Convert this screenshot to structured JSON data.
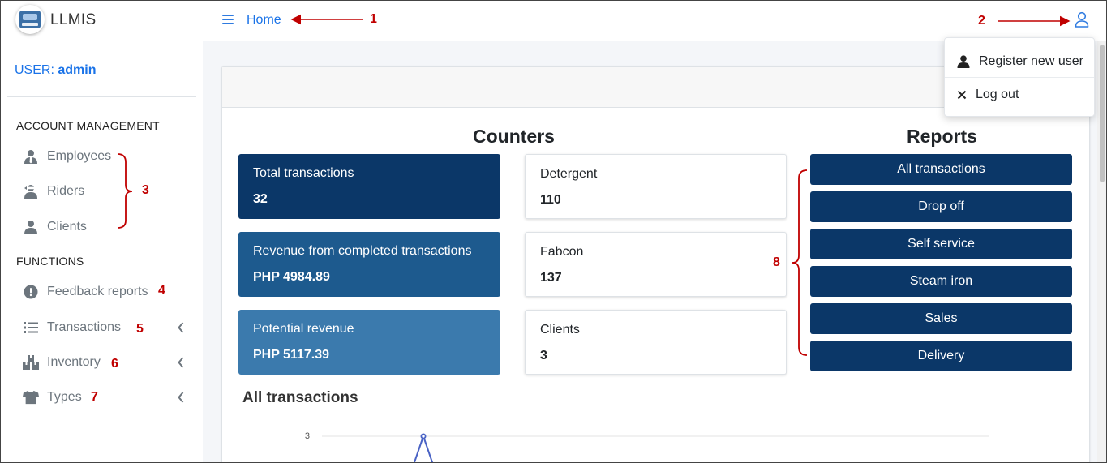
{
  "app": {
    "brand": "LLMIS"
  },
  "topbar": {
    "home_label": "Home"
  },
  "sidebar": {
    "user_prefix": "USER:",
    "user_name": "admin",
    "account_header": "ACCOUNT MANAGEMENT",
    "account_items": [
      {
        "label": "Employees",
        "icon": "user-tie-icon"
      },
      {
        "label": "Riders",
        "icon": "user-ninja-icon"
      },
      {
        "label": "Clients",
        "icon": "user-icon"
      }
    ],
    "functions_header": "FUNCTIONS",
    "function_items": [
      {
        "label": "Feedback reports",
        "icon": "exclamation-circle-icon",
        "expandable": false
      },
      {
        "label": "Transactions",
        "icon": "list-icon",
        "expandable": true
      },
      {
        "label": "Inventory",
        "icon": "boxes-icon",
        "expandable": true
      },
      {
        "label": "Types",
        "icon": "tshirt-icon",
        "expandable": true
      }
    ]
  },
  "dropdown": {
    "items": [
      {
        "label": "Register new user",
        "icon": "user-icon"
      },
      {
        "label": "Log out",
        "icon": "close-icon"
      }
    ]
  },
  "main": {
    "counters_title": "Counters",
    "reports_title": "Reports",
    "counters_left": [
      {
        "title": "Total transactions",
        "value": "32",
        "color": "#0b3768"
      },
      {
        "title": "Revenue from completed transactions",
        "value": "PHP 4984.89",
        "color": "#1d5a8e"
      },
      {
        "title": "Potential revenue",
        "value": "PHP 5117.39",
        "color": "#3b7aad"
      }
    ],
    "counters_right": [
      {
        "title": "Detergent",
        "value": "110"
      },
      {
        "title": "Fabcon",
        "value": "137"
      },
      {
        "title": "Clients",
        "value": "3"
      }
    ],
    "reports": [
      "All transactions",
      "Drop off",
      "Self service",
      "Steam iron",
      "Sales",
      "Delivery"
    ]
  },
  "chart_data": {
    "type": "line",
    "title": "All transactions",
    "y_tick_labels": [
      "3"
    ],
    "series": [
      {
        "values": [
          3
        ]
      }
    ],
    "color": "#4a63c5"
  },
  "annotations": [
    "1",
    "2",
    "3",
    "4",
    "5",
    "6",
    "7",
    "8"
  ],
  "colors": {
    "accent": "#1a73e8",
    "primary_dark": "#0b3768",
    "annotation": "#c00000"
  }
}
